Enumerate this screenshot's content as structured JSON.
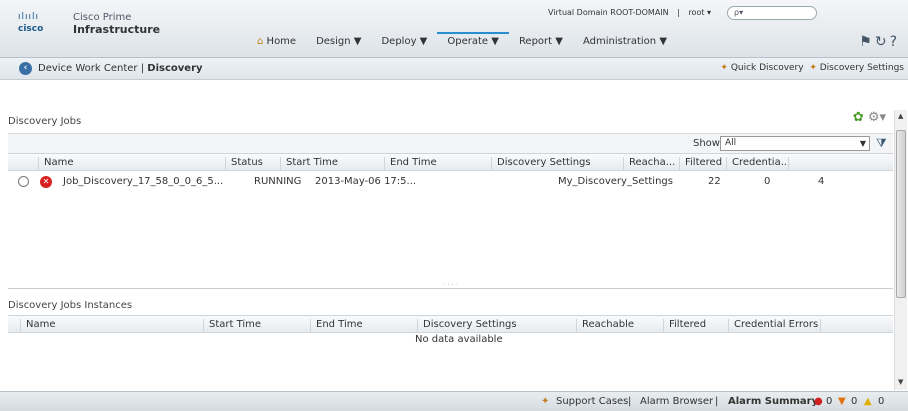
{
  "header": {
    "brand_bars": "ılıılı",
    "brand_word": "cisco",
    "product_line1": "Cisco Prime",
    "product_line2": "Infrastructure",
    "virtual_domain": "Virtual Domain ROOT-DOMAIN",
    "separator": "|",
    "user": "root ▾",
    "search_placeholder": "ρ▾"
  },
  "nav": [
    {
      "label": "Home",
      "icon": "home-icon"
    },
    {
      "label": "Design ▼"
    },
    {
      "label": "Deploy ▼"
    },
    {
      "label": "Operate ▼",
      "active": true
    },
    {
      "label": "Report ▼"
    },
    {
      "label": "Administration ▼"
    }
  ],
  "breadcrumb": {
    "parent": "Device Work Center",
    "separator": "|",
    "current": "Discovery",
    "quick_discovery": "Quick Discovery",
    "discovery_settings": "Discovery Settings"
  },
  "jobs": {
    "title": "Discovery Jobs",
    "show_label": "Show",
    "show_value": "All",
    "columns": [
      "Name",
      "Status",
      "Start Time",
      "End Time",
      "Discovery Settings",
      "Reacha...",
      "Filtered",
      "Credentia..."
    ],
    "rows": [
      {
        "name": "Job_Discovery_17_58_0_0_6_5...",
        "status": "RUNNING",
        "start_time": "2013-May-06 17:5...",
        "end_time": "",
        "settings": "My_Discovery_Settings",
        "reachable": "22",
        "filtered": "0",
        "credential": "4"
      }
    ]
  },
  "instances": {
    "title": "Discovery Jobs Instances",
    "columns": [
      "Name",
      "Start Time",
      "End Time",
      "Discovery Settings",
      "Reachable",
      "Filtered",
      "Credential Errors"
    ],
    "empty": "No data available"
  },
  "footer": {
    "support": "Support Cases",
    "sep1": "|",
    "alarm_browser": "Alarm Browser",
    "sep2": "|",
    "alarm_summary": "Alarm Summary",
    "critical": "0",
    "major": "0",
    "minor": "0"
  },
  "colors": {
    "accent": "#2a8fd0",
    "critical": "#d82020"
  }
}
